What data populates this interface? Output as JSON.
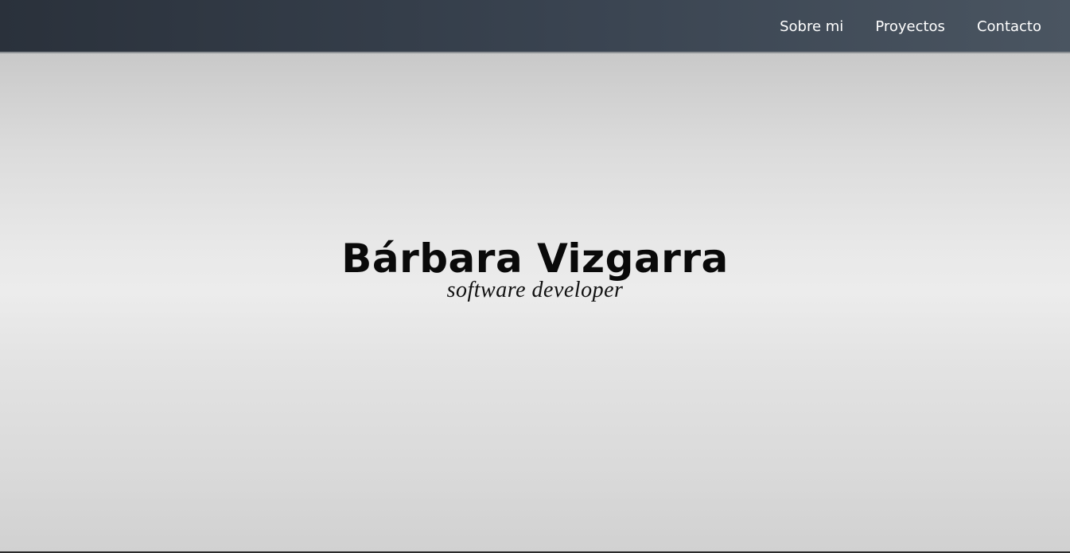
{
  "navbar": {
    "links": [
      {
        "label": "Sobre mi"
      },
      {
        "label": "Proyectos"
      },
      {
        "label": "Contacto"
      }
    ]
  },
  "hero": {
    "title": "Bárbara Vizgarra",
    "subtitle": "software developer"
  },
  "colors": {
    "navbar_start": "#2a313b",
    "navbar_end": "#4a5561",
    "hero_background": "#e9e9e9",
    "text_dark": "#0a0a0a",
    "nav_text": "#ffffff"
  }
}
